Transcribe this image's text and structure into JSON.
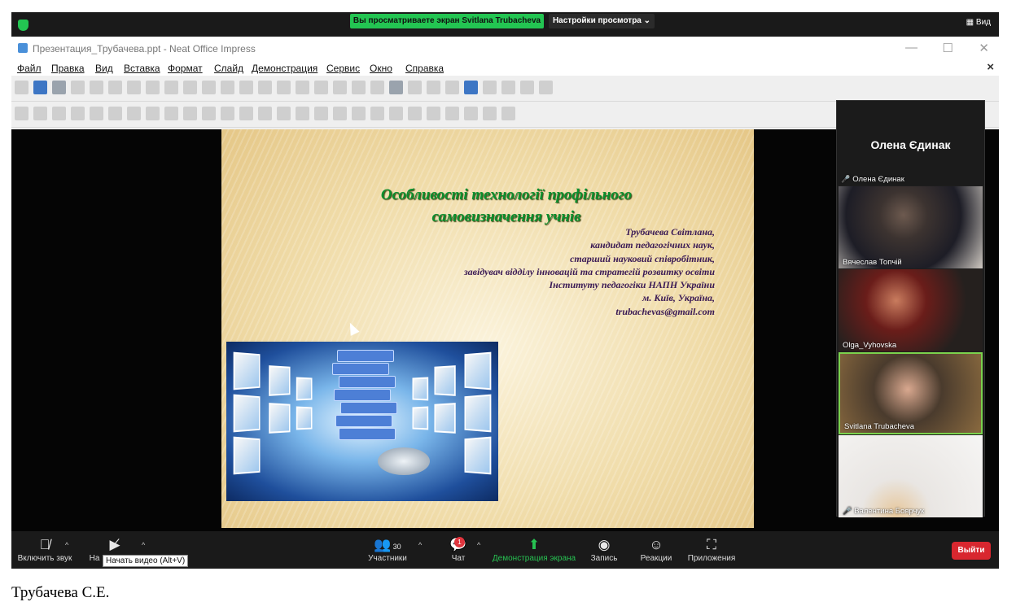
{
  "zoom": {
    "share_notice": "Вы просматриваете экран Svitlana Trubacheva",
    "view_settings": "Настройки просмотра ⌄",
    "view_button": "▦ Вид"
  },
  "impress": {
    "window_title": "Презентация_Трубачева.ppt - Neat Office Impress",
    "menu": [
      "Файл",
      "Правка",
      "Вид",
      "Вставка",
      "Формат",
      "Слайд",
      "Демонстрация",
      "Сервис",
      "Окно",
      "Справка"
    ]
  },
  "slide": {
    "title_line1": "Особливості технології профільного",
    "title_line2": "самовизначення учнів",
    "author_lines": [
      "Трубачева Світлана,",
      "кандидат педагогічних наук,",
      "старший науковий співробітник,",
      "завідувач відділу інновацій та стратегій розвитку освіти",
      "Інституту педагогіки НАПН України",
      "м. Київ, Україна,",
      "trubachevas@gmail.com"
    ]
  },
  "gallery": {
    "active_speaker": "Олена Єдинак",
    "active_speaker_label": "Олена Єдинак",
    "tiles": [
      "Вячеслав Топчій",
      "Olga_Vyhovska",
      "Svitlana Trubacheva",
      "Валентина Боярчук"
    ]
  },
  "toolbar": {
    "mute_label": "Включить звук",
    "video_label": "На",
    "video_tooltip": "Начать видео (Alt+V)",
    "participants_label": "Участники",
    "participants_count": "30",
    "chat_label": "Чат",
    "chat_badge": "1",
    "share_label": "Демонстрация экрана",
    "record_label": "Запись",
    "reactions_label": "Реакции",
    "apps_label": "Приложения",
    "leave_label": "Выйти"
  },
  "caption": "Трубачева С.Е."
}
